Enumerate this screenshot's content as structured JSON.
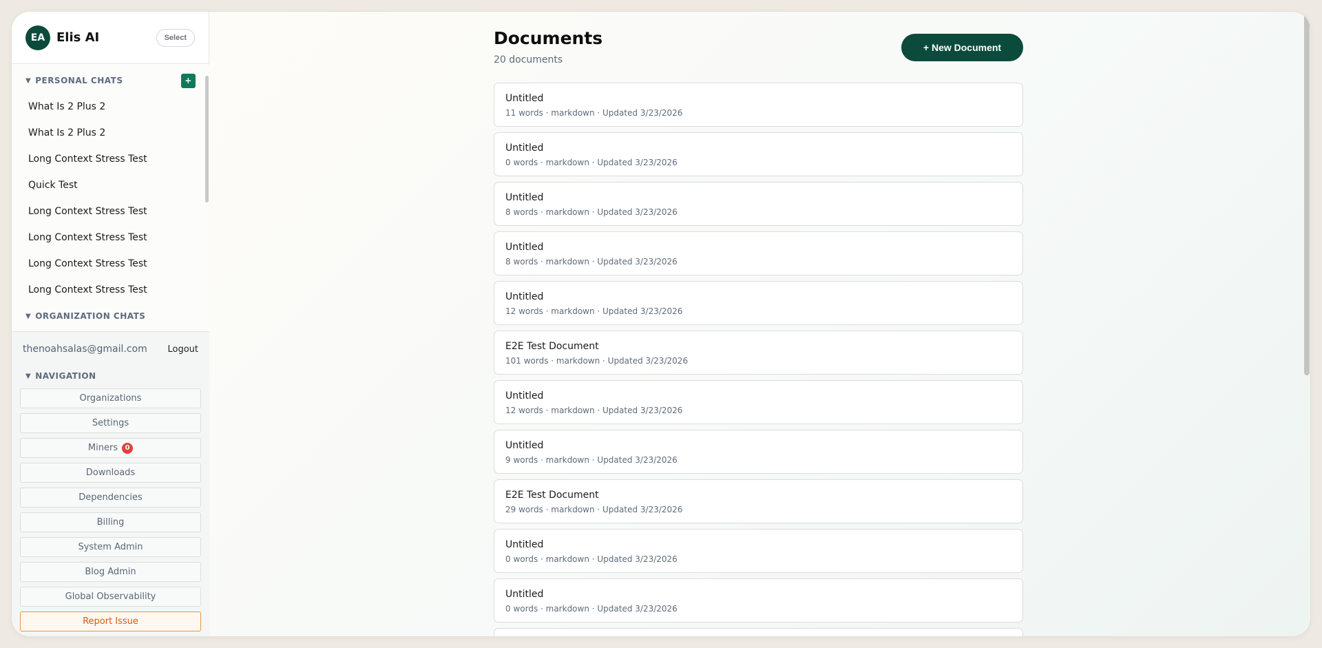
{
  "sidebar": {
    "avatar_initials": "EA",
    "org_name": "Elis AI",
    "select_label": "Select",
    "personal_section": "PERSONAL CHATS",
    "add_chat_label": "+",
    "chats": [
      "What Is 2 Plus 2",
      "What Is 2 Plus 2",
      "Long Context Stress Test",
      "Quick Test",
      "Long Context Stress Test",
      "Long Context Stress Test",
      "Long Context Stress Test",
      "Long Context Stress Test"
    ],
    "org_section": "ORGANIZATION CHATS",
    "user_email": "thenoahsalas@gmail.com",
    "logout_label": "Logout",
    "nav_section": "NAVIGATION",
    "nav": {
      "organizations": "Organizations",
      "settings": "Settings",
      "miners": "Miners",
      "miners_badge": "0",
      "downloads": "Downloads",
      "dependencies": "Dependencies",
      "billing": "Billing",
      "system_admin": "System Admin",
      "blog_admin": "Blog Admin",
      "global_observability": "Global Observability",
      "report_issue": "Report Issue"
    }
  },
  "main": {
    "title": "Documents",
    "count": "20 documents",
    "new_button": "+ New Document",
    "documents": [
      {
        "title": "Untitled",
        "meta": "11 words · markdown · Updated 3/23/2026"
      },
      {
        "title": "Untitled",
        "meta": "0 words · markdown · Updated 3/23/2026"
      },
      {
        "title": "Untitled",
        "meta": "8 words · markdown · Updated 3/23/2026"
      },
      {
        "title": "Untitled",
        "meta": "8 words · markdown · Updated 3/23/2026"
      },
      {
        "title": "Untitled",
        "meta": "12 words · markdown · Updated 3/23/2026"
      },
      {
        "title": "E2E Test Document",
        "meta": "101 words · markdown · Updated 3/23/2026"
      },
      {
        "title": "Untitled",
        "meta": "12 words · markdown · Updated 3/23/2026"
      },
      {
        "title": "Untitled",
        "meta": "9 words · markdown · Updated 3/23/2026"
      },
      {
        "title": "E2E Test Document",
        "meta": "29 words · markdown · Updated 3/23/2026"
      },
      {
        "title": "Untitled",
        "meta": "0 words · markdown · Updated 3/23/2026"
      },
      {
        "title": "Untitled",
        "meta": "0 words · markdown · Updated 3/23/2026"
      },
      {
        "title": "",
        "meta": ""
      }
    ]
  },
  "colors": {
    "brand": "#0c4a3c",
    "accent_green": "#0f7a5a",
    "badge_red": "#e53e3e",
    "report_orange": "#d65a0f"
  }
}
